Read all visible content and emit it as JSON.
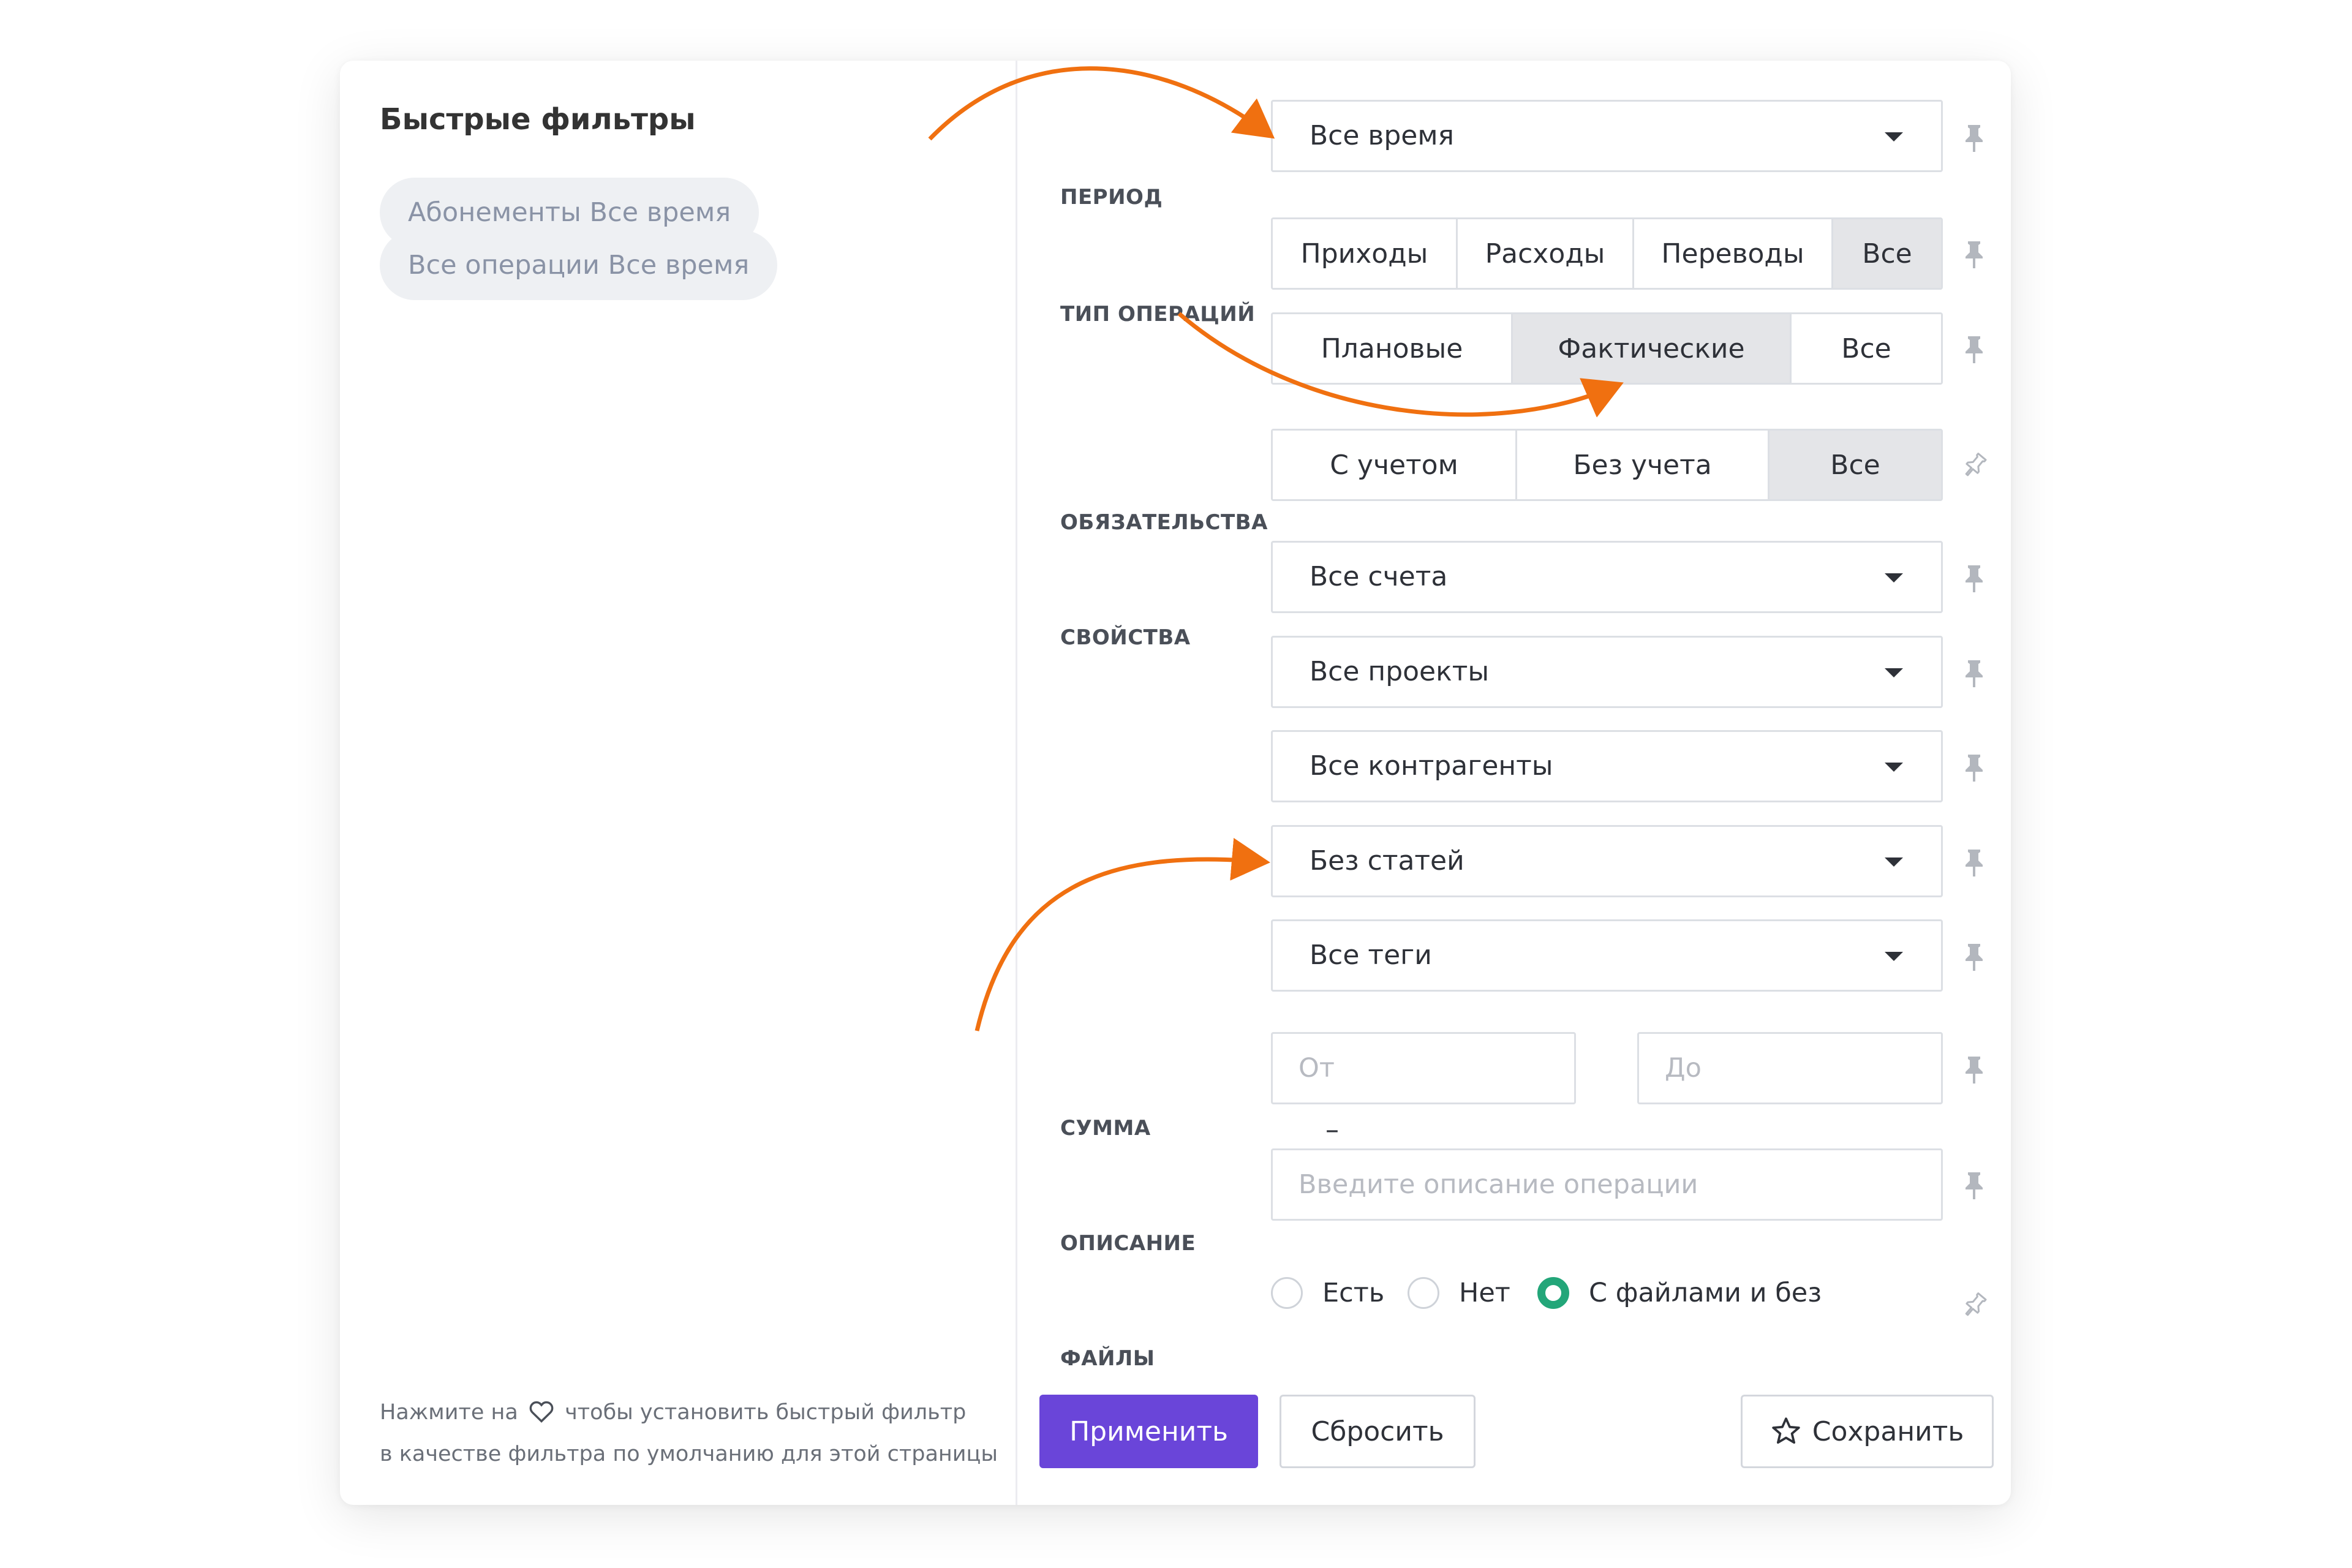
{
  "quick_filters": {
    "title": "Быстрые фильтры",
    "chips": [
      "Абонементы Все время",
      "Все операции Все время"
    ],
    "hint_before_icon": "Нажмите на",
    "hint_icon": "heart-icon",
    "hint_after_icon": "чтобы установить быстрый фильтр",
    "hint_line2": "в качестве фильтра по умолчанию для этой страницы"
  },
  "filters": {
    "period": {
      "label": "ПЕРИОД",
      "value": "Все время"
    },
    "op_type": {
      "label": "ТИП ОПЕРАЦИЙ",
      "options": [
        "Приходы",
        "Расходы",
        "Переводы",
        "Все"
      ],
      "selected": "Все",
      "plan_options": [
        "Плановые",
        "Фактические",
        "Все"
      ],
      "plan_selected": "Фактические"
    },
    "obligations": {
      "label": "ОБЯЗАТЕЛЬСТВА",
      "options": [
        "С учетом",
        "Без учета",
        "Все"
      ],
      "selected": "Все"
    },
    "properties": {
      "label": "СВОЙСТВА",
      "accounts": "Все счета",
      "projects": "Все проекты",
      "counterparties": "Все контрагенты",
      "articles": "Без статей",
      "tags": "Все теги"
    },
    "amount": {
      "label": "СУММА",
      "from_placeholder": "От",
      "separator": "–",
      "to_placeholder": "До"
    },
    "description": {
      "label": "ОПИСАНИЕ",
      "placeholder": "Введите описание операции"
    },
    "files": {
      "label": "ФАЙЛЫ",
      "options": [
        "Есть",
        "Нет",
        "С файлами и без"
      ],
      "selected": "С файлами и без"
    }
  },
  "actions": {
    "apply": "Применить",
    "reset": "Сбросить",
    "save": "Сохранить"
  },
  "colors": {
    "accent": "#6a45d9",
    "radio_on": "#23a679",
    "annotation_arrow": "#f07010",
    "segment_active": "#e4e5e8"
  }
}
